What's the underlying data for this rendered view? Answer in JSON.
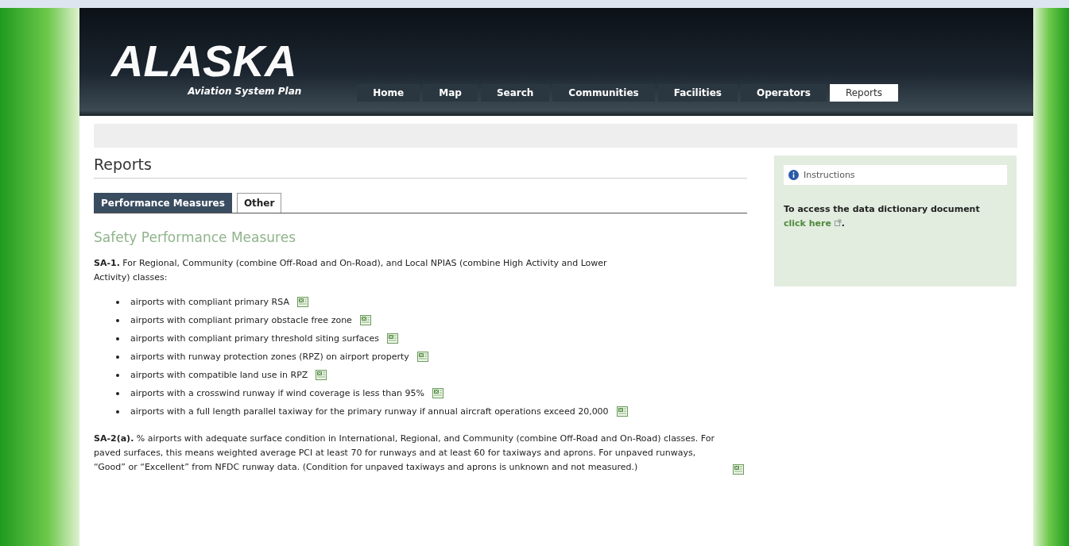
{
  "logo": {
    "title": "ALASKA",
    "subtitle": "Aviation System Plan"
  },
  "nav": [
    {
      "label": "Home",
      "selected": false
    },
    {
      "label": "Map",
      "selected": false
    },
    {
      "label": "Search",
      "selected": false
    },
    {
      "label": "Communities",
      "selected": false
    },
    {
      "label": "Facilities",
      "selected": false
    },
    {
      "label": "Operators",
      "selected": false
    },
    {
      "label": "Reports",
      "selected": true
    }
  ],
  "page_title": "Reports",
  "tabs": [
    {
      "label": "Performance Measures",
      "selected": true
    },
    {
      "label": "Other",
      "selected": false
    }
  ],
  "section_title": "Safety Performance Measures",
  "measures": [
    {
      "text": "**SA-1.** For Regional, Community (combine Off-Road and On-Road), and Local NPIAS (combine High Activity and Lower Activity) classes:",
      "items": [
        {
          "text": "airports with compliant primary RSA",
          "report": true
        },
        {
          "text": "airports with compliant primary obstacle free zone",
          "report": true
        },
        {
          "text": "airports with compliant primary threshold siting surfaces",
          "report": true
        },
        {
          "text": "airports with runway protection zones (RPZ) on airport property",
          "report": true
        },
        {
          "text": "airports with compatible land use in RPZ",
          "report": true
        },
        {
          "text": "airports with a crosswind runway if wind coverage is less than 95%",
          "report": true
        },
        {
          "text": "airports with a full length parallel taxiway for the primary runway if annual aircraft operations exceed 20,000",
          "report": true
        }
      ]
    },
    {
      "text": "**SA-2(a).** % airports with adequate surface condition in International, Regional, and Community (combine Off-Road and On-Road) classes. For paved surfaces, this means weighted average PCI at least 70 for runways and at least 60 for taxiways and aprons. For unpaved runways, “Good” or “Excellent” from NFDC runway data. (Condition for unpaved taxiways and aprons is unknown and not measured.)",
      "report": true
    }
  ],
  "sidebar": {
    "title": "Instructions",
    "text": "To access the data dictionary document",
    "link": "click here",
    "after": "."
  }
}
